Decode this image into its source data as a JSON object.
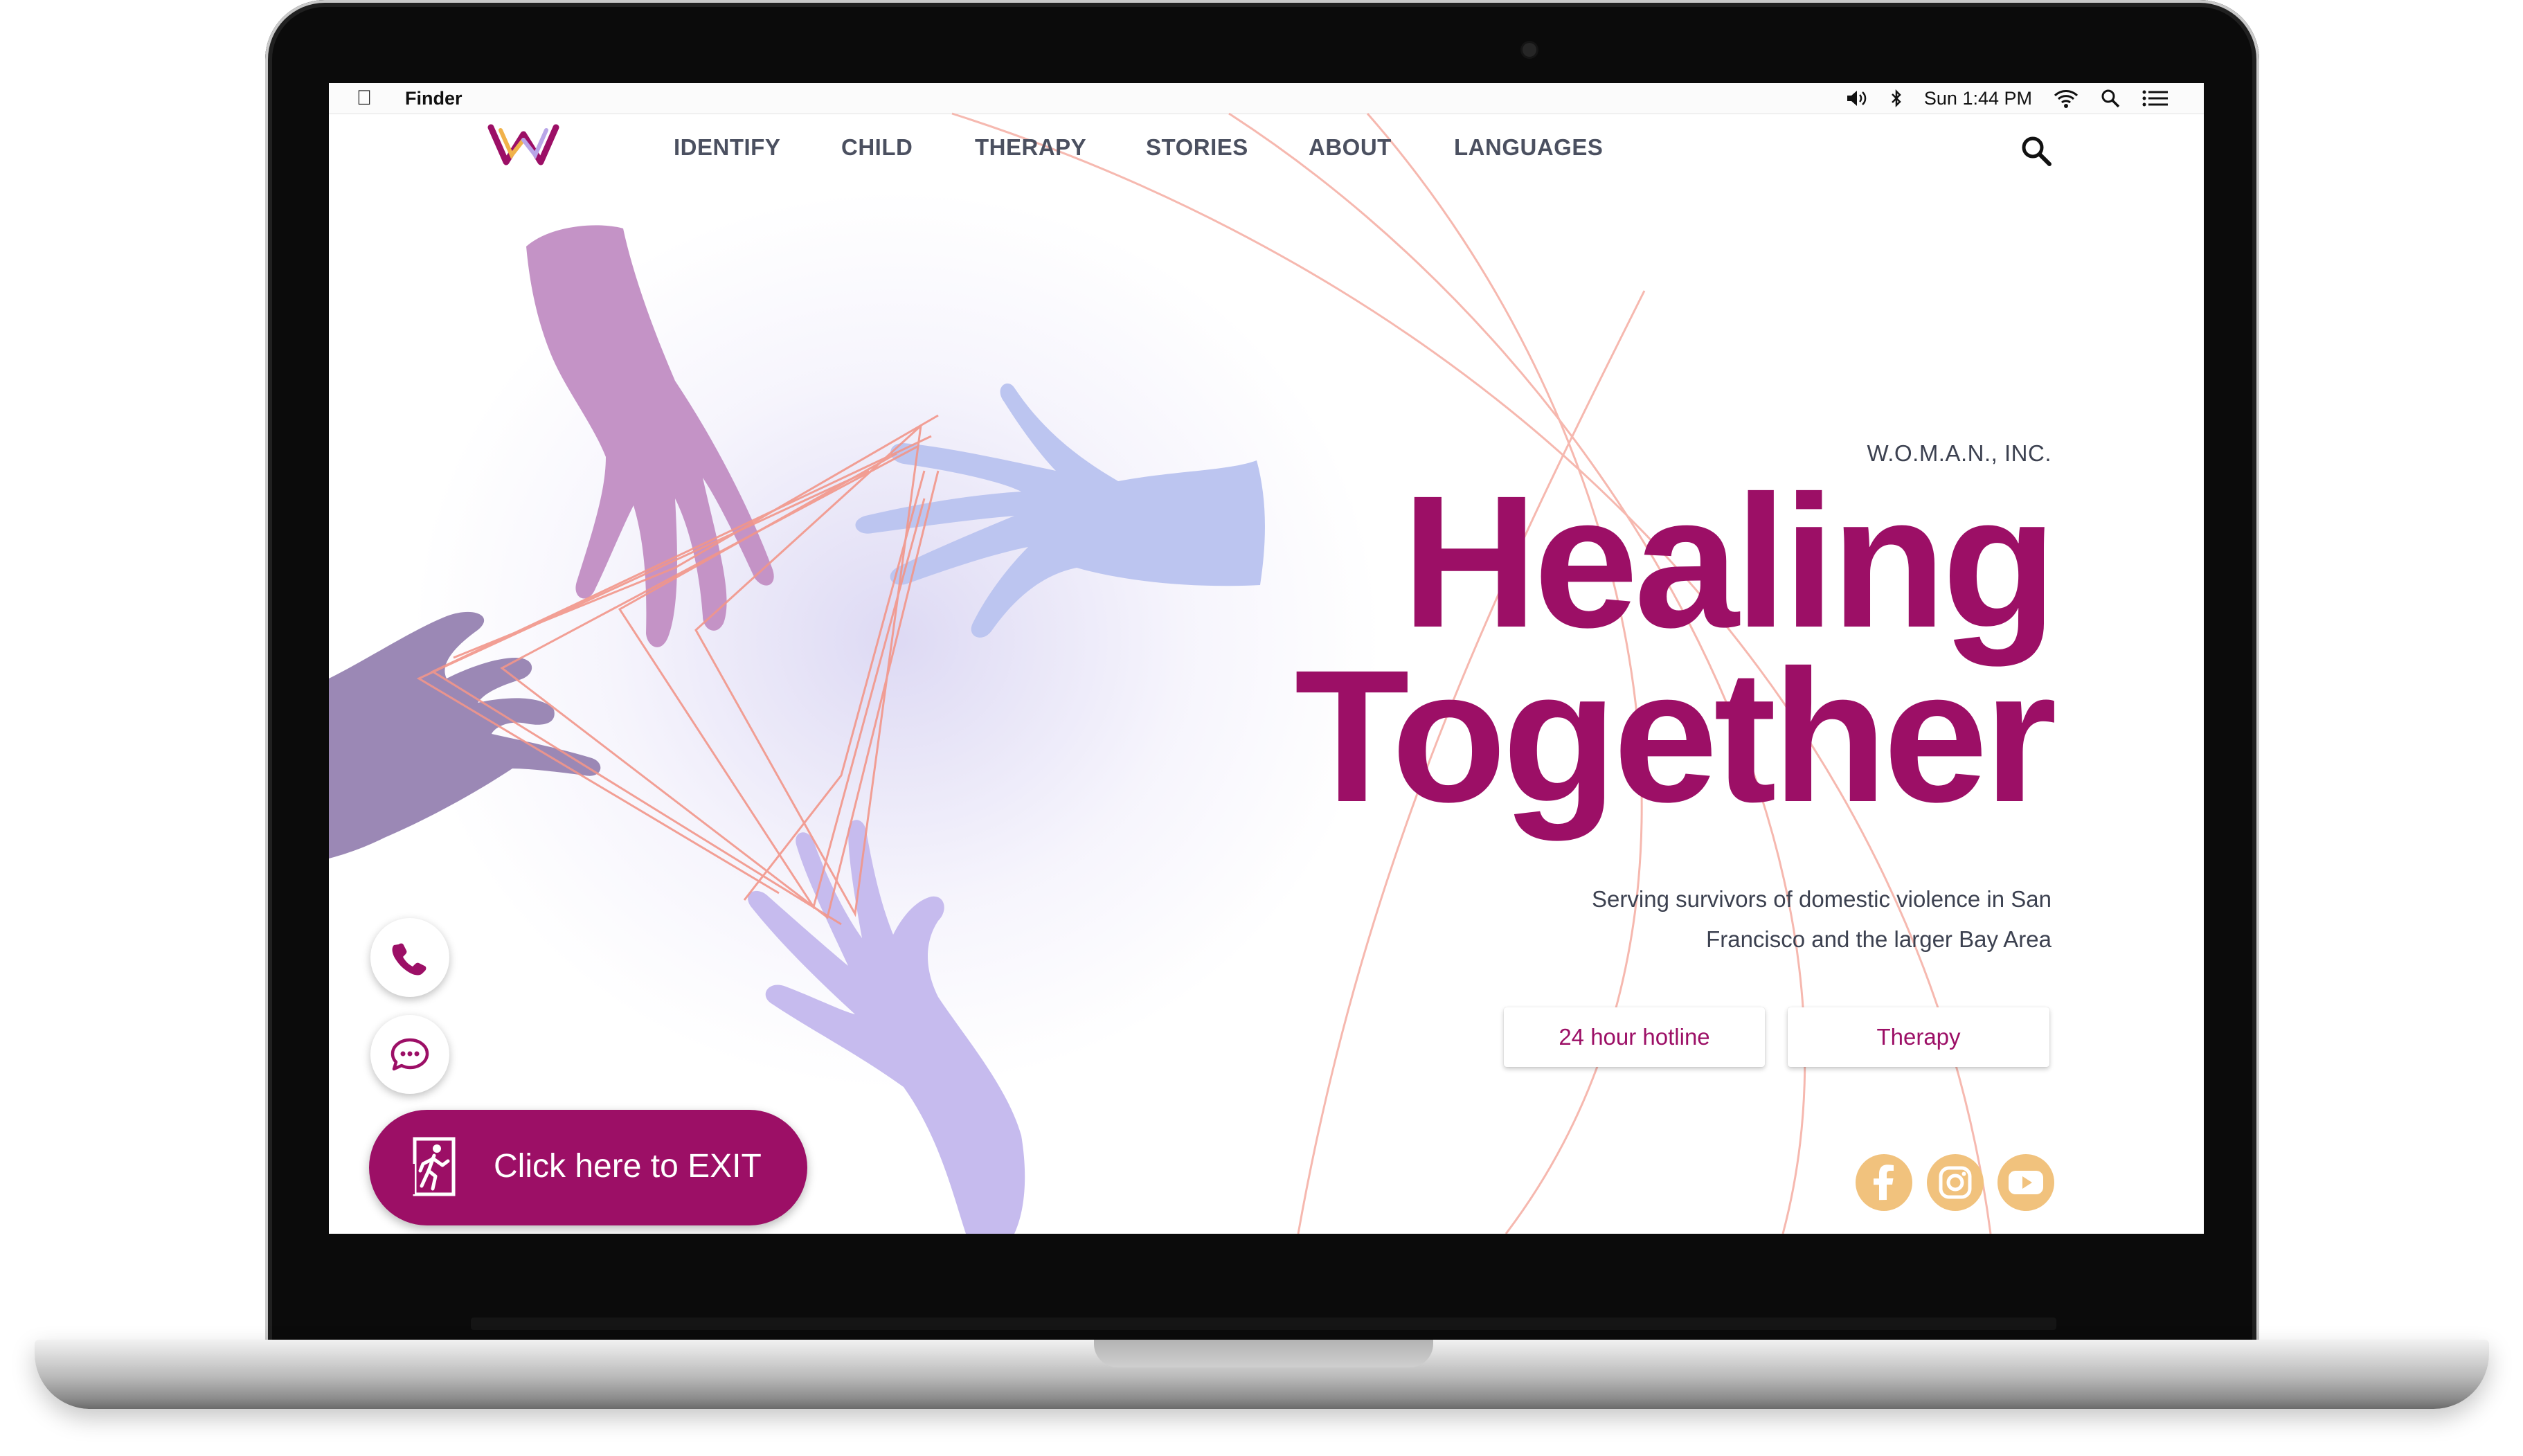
{
  "menubar": {
    "app_name": "Finder",
    "clock": "Sun 1:44 PM",
    "icons": [
      "apple-icon",
      "volume-icon",
      "bluetooth-icon",
      "wifi-icon",
      "spotlight-icon",
      "notification-center-icon"
    ]
  },
  "nav": {
    "items": [
      {
        "label": "IDENTIFY"
      },
      {
        "label": "CHILD"
      },
      {
        "label": "THERAPY"
      },
      {
        "label": "STORIES"
      },
      {
        "label": "ABOUT"
      },
      {
        "label": "LANGUAGES"
      }
    ],
    "search_icon": "search-icon"
  },
  "hero": {
    "org_name": "W.O.M.A.N., INC.",
    "headline_line1": "Healing",
    "headline_line2": "Together",
    "subtitle": "Serving survivors of domestic violence in San Francisco and the larger Bay Area",
    "buttons": [
      {
        "label": "24 hour hotline"
      },
      {
        "label": "Therapy"
      }
    ]
  },
  "social": [
    "facebook-icon",
    "instagram-icon",
    "youtube-icon"
  ],
  "floating": {
    "call_icon": "phone-icon",
    "chat_icon": "chat-icon",
    "exit_label": "Click here to EXIT",
    "exit_icon": "emergency-exit-icon"
  },
  "colors": {
    "brand_magenta": "#9c0f66",
    "nav_text": "#4b5060",
    "social_gold": "#f1c27d",
    "hand_mauve": "#bd8fc4",
    "hand_periwinkle": "#b8c4f0",
    "hand_grape": "#9a88b8",
    "hand_lavender": "#c4b8ee",
    "string_coral": "#f2968a"
  }
}
